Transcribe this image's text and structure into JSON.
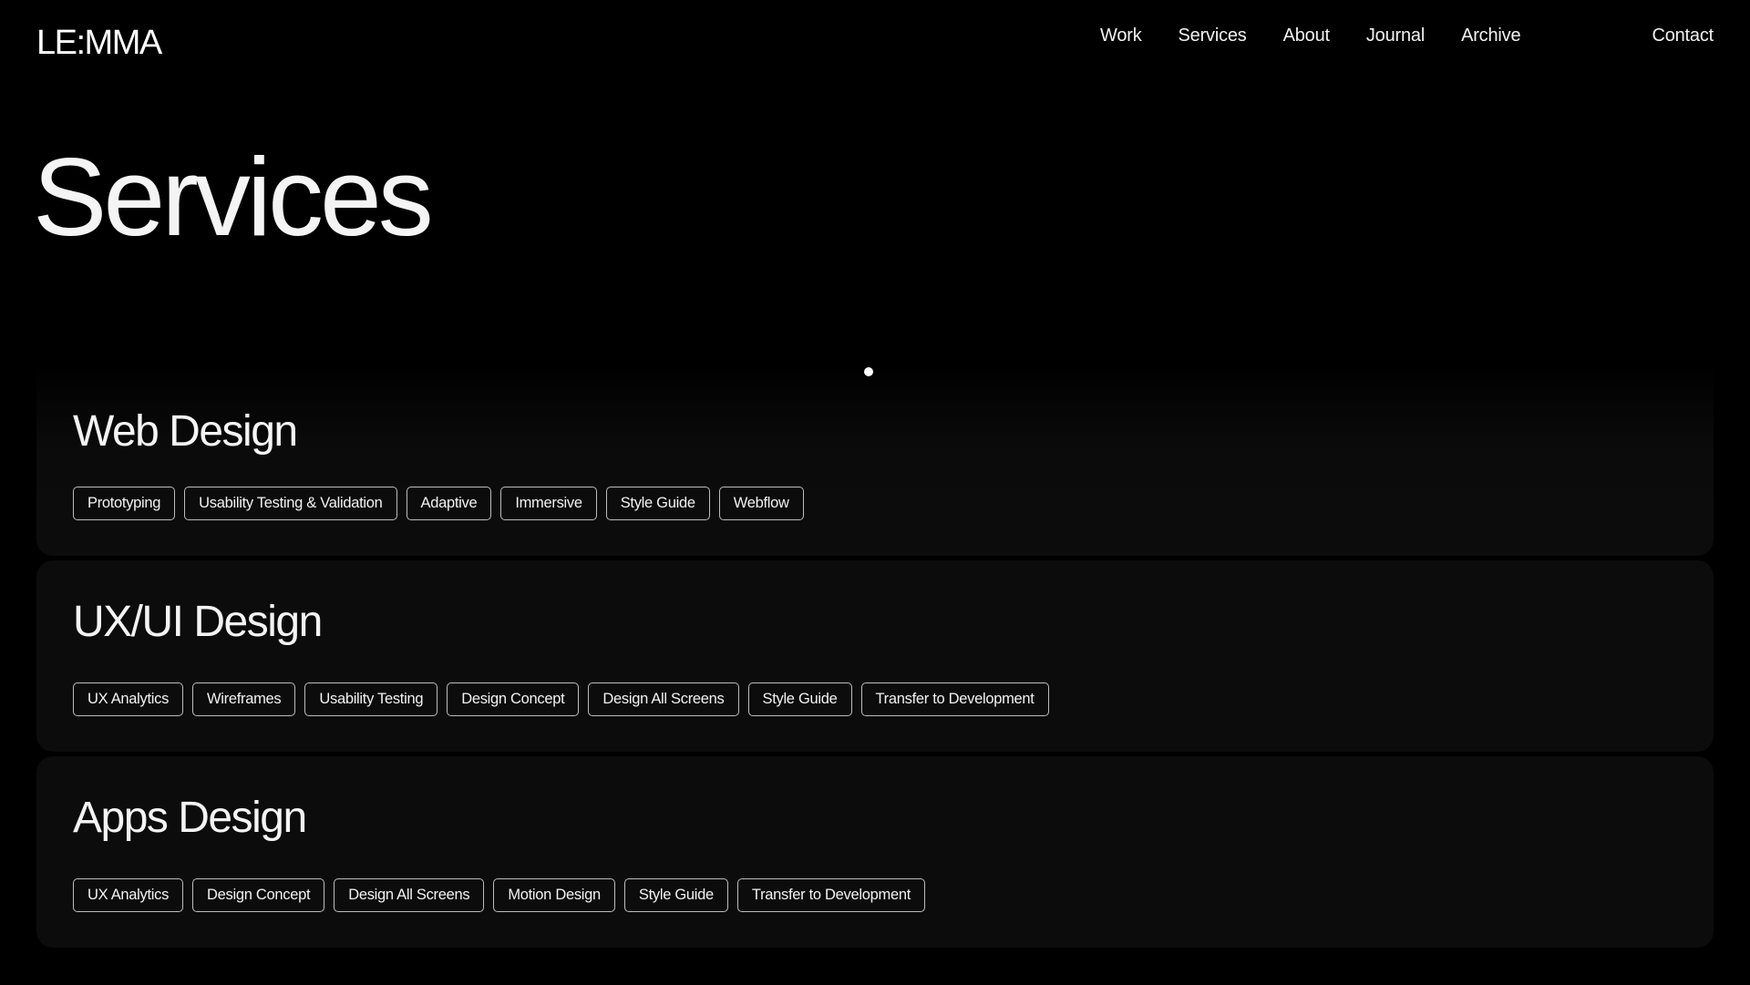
{
  "header": {
    "logo": "LE:MMA",
    "nav": [
      "Work",
      "Services",
      "About",
      "Journal",
      "Archive"
    ],
    "contact": "Contact"
  },
  "page": {
    "title": "Services"
  },
  "services": [
    {
      "title": "Web Design",
      "tags": [
        "Prototyping",
        "Usability Testing & Validation",
        "Adaptive",
        "Immersive",
        "Style Guide",
        "Webflow"
      ]
    },
    {
      "title": "UX/UI Design",
      "tags": [
        "UX Analytics",
        "Wireframes",
        "Usability Testing",
        "Design Concept",
        "Design All Screens",
        "Style Guide",
        "Transfer to Development"
      ]
    },
    {
      "title": "Apps Design",
      "tags": [
        "UX Analytics",
        "Design Concept",
        "Design All Screens",
        "Motion Design",
        "Style Guide",
        "Transfer to Development"
      ]
    }
  ],
  "colors": {
    "background": "#000000",
    "card": "#0c0c0c",
    "text": "#f2f2f2",
    "tag_border": "#bdbdbd"
  }
}
